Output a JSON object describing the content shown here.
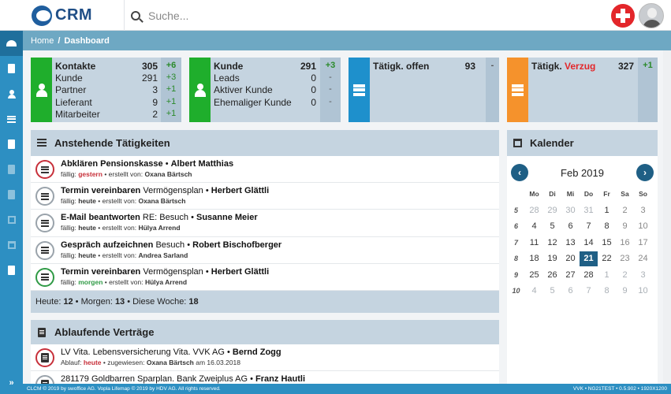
{
  "app": {
    "title": "CRM"
  },
  "search": {
    "placeholder": "Suche..."
  },
  "breadcrumb": {
    "home": "Home",
    "separator": "/",
    "current": "Dashboard"
  },
  "sidebar": {
    "expand_label": "»"
  },
  "stats": {
    "contacts": {
      "rows": [
        {
          "label": "Kontakte",
          "value": "305",
          "delta": "+6"
        },
        {
          "label": "Kunde",
          "value": "291",
          "delta": "+3"
        },
        {
          "label": "Partner",
          "value": "3",
          "delta": "+1"
        },
        {
          "label": "Lieferant",
          "value": "9",
          "delta": "+1"
        },
        {
          "label": "Mitarbeiter",
          "value": "2",
          "delta": "+1"
        }
      ]
    },
    "customers": {
      "rows": [
        {
          "label": "Kunde",
          "value": "291",
          "delta": "+3"
        },
        {
          "label": "Leads",
          "value": "0",
          "delta": "-"
        },
        {
          "label": "Aktiver Kunde",
          "value": "0",
          "delta": "-"
        },
        {
          "label": "Ehemaliger Kunde",
          "value": "0",
          "delta": "-"
        }
      ]
    },
    "open_tasks": {
      "label": "Tätigk. offen",
      "value": "93",
      "delta": "-"
    },
    "late_tasks": {
      "label": "Tätigk.",
      "label_highlight": "Verzug",
      "value": "327",
      "delta": "+1"
    }
  },
  "tasks": {
    "title": "Anstehende Tätigkeiten",
    "items": [
      {
        "action": "Abklären Pensionskasse",
        "subject": "",
        "sep": "•",
        "person": "Albert Matthias",
        "due_label": "fällig:",
        "due": "gestern",
        "creator_label": "• erstellt von:",
        "creator": "Oxana Bärtsch"
      },
      {
        "action": "Termin vereinbaren",
        "subject": "Vermögensplan",
        "sep": "•",
        "person": "Herbert Glättli",
        "due_label": "fällig:",
        "due": "heute",
        "creator_label": "• erstellt von:",
        "creator": "Oxana Bärtsch"
      },
      {
        "action": "E-Mail beantworten",
        "subject": "RE: Besuch",
        "sep": "•",
        "person": "Susanne Meier",
        "due_label": "fällig:",
        "due": "heute",
        "creator_label": "• erstellt von:",
        "creator": "Hülya Arrend"
      },
      {
        "action": "Gespräch aufzeichnen",
        "subject": "Besuch",
        "sep": "•",
        "person": "Robert Bischofberger",
        "due_label": "fällig:",
        "due": "heute",
        "creator_label": "• erstellt von:",
        "creator": "Andrea Sarland"
      },
      {
        "action": "Termin vereinbaren",
        "subject": "Vermögensplan",
        "sep": "•",
        "person": "Herbert Glättli",
        "due_label": "fällig:",
        "due": "morgen",
        "creator_label": "• erstellt von:",
        "creator": "Hülya Arrend"
      }
    ],
    "summary": {
      "today_label": "Heute:",
      "today": "12",
      "tomorrow_label": "• Morgen:",
      "tomorrow": "13",
      "week_label": "• Diese Woche:",
      "week": "18"
    }
  },
  "contracts": {
    "title": "Ablaufende Verträge",
    "items": [
      {
        "text": "LV Vita. Lebensversicherung Vita. VVK AG",
        "sep": "•",
        "person": "Bernd Zogg",
        "expiry_label": "Ablauf:",
        "expiry": "heute",
        "assigned_label": "• zugewiesen:",
        "assigned": "Oxana Bärtsch",
        "date_label": "am",
        "date": "16.03.2018"
      },
      {
        "text": "281179 Goldbarren Sparplan. Bank Zweiplus AG",
        "sep": "•",
        "person": "Franz Hautli",
        "expiry_label": "",
        "expiry": "",
        "assigned_label": "",
        "assigned": "",
        "date_label": "",
        "date": ""
      }
    ]
  },
  "calendar": {
    "title": "Kalender",
    "month": "Feb 2019",
    "prev": "‹",
    "next": "›",
    "weekdays": [
      "Mo",
      "Di",
      "Mi",
      "Do",
      "Fr",
      "Sa",
      "So"
    ],
    "weeks": [
      {
        "wk": "5",
        "days": [
          "28",
          "29",
          "30",
          "31",
          "1",
          "2",
          "3"
        ]
      },
      {
        "wk": "6",
        "days": [
          "4",
          "5",
          "6",
          "7",
          "8",
          "9",
          "10"
        ]
      },
      {
        "wk": "7",
        "days": [
          "11",
          "12",
          "13",
          "14",
          "15",
          "16",
          "17"
        ]
      },
      {
        "wk": "8",
        "days": [
          "18",
          "19",
          "20",
          "21",
          "22",
          "23",
          "24"
        ]
      },
      {
        "wk": "9",
        "days": [
          "25",
          "26",
          "27",
          "28",
          "1",
          "2",
          "3"
        ]
      },
      {
        "wk": "10",
        "days": [
          "4",
          "5",
          "6",
          "7",
          "8",
          "9",
          "10"
        ]
      }
    ],
    "today": "21"
  },
  "footer": {
    "left": "CLCM © 2019 by swoffice AG. Vopla Lifemap © 2019 by HDV AG. All rights reserved.",
    "right": "VVK • NG21TEST • 0.5.902 • 1920X1200"
  },
  "colors": {
    "accent": "#2d8fc2",
    "green": "#1fae2c",
    "blue": "#1e90cc",
    "orange": "#f5922c",
    "red": "#e3262a",
    "header_bg": "#c5d4e0"
  }
}
